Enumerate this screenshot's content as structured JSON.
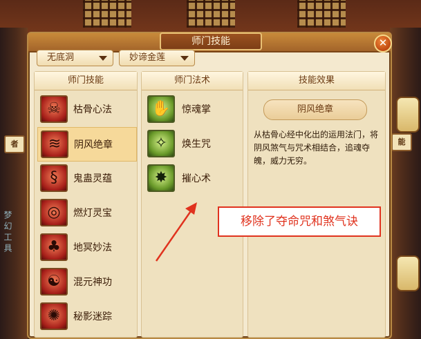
{
  "window": {
    "title": "师门技能",
    "close_glyph": "✕"
  },
  "filters": {
    "faction": "无底洞",
    "sub_faction": "妙谛金莲"
  },
  "columns": {
    "skills_header": "师门技能",
    "spells_header": "师门法术",
    "effect_header": "技能效果"
  },
  "skills": [
    {
      "label": "枯骨心法",
      "icon": "skull-hand-icon",
      "selected": false
    },
    {
      "label": "阴风绝章",
      "icon": "wind-scroll-icon",
      "selected": true
    },
    {
      "label": "鬼蛊灵蕴",
      "icon": "ghost-worm-icon",
      "selected": false
    },
    {
      "label": "燃灯灵宝",
      "icon": "lamp-wheel-icon",
      "selected": false
    },
    {
      "label": "地冥妙法",
      "icon": "underworld-tree-icon",
      "selected": false
    },
    {
      "label": "混元神功",
      "icon": "chaos-figure-icon",
      "selected": false
    },
    {
      "label": "秘影迷踪",
      "icon": "shadow-swirl-icon",
      "selected": false
    }
  ],
  "spells": [
    {
      "label": "惊魂掌",
      "icon": "palm-icon"
    },
    {
      "label": "焕生咒",
      "icon": "revive-figure-icon"
    },
    {
      "label": "摧心术",
      "icon": "heart-shatter-icon"
    }
  ],
  "effect": {
    "name": "阴风绝章",
    "description": "从枯骨心经中化出的运用法门，将阴风煞气与咒术相结合，追魂夺魄，威力无穷。"
  },
  "annotation": {
    "text": "移除了夺命咒和煞气诀",
    "color": "#e0321e"
  },
  "background": {
    "signs": [
      "者",
      "能"
    ],
    "side_text": "梦幻工具"
  },
  "colors": {
    "panel": "#f4e9cf",
    "selected_row": "#f6d99a",
    "accent_red": "#e0321e"
  }
}
